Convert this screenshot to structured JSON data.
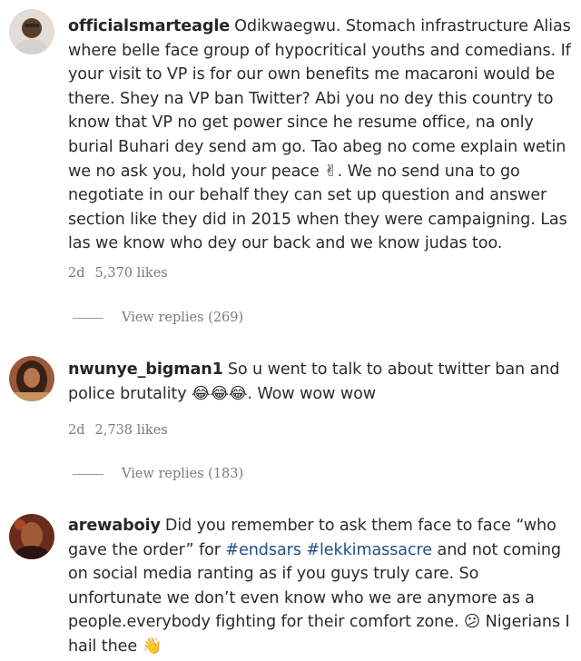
{
  "comments": [
    {
      "username": "officialsmarteagle",
      "avatar_icon": "user-avatar-photo",
      "text": "Odikwaegwu. Stomach infrastructure Alias where belle face group of hypocritical youths and comedians. If your visit to VP is for our own benefits me macaroni would be there. Shey na VP ban Twitter? Abi you no dey this country to know that VP no get power since he resume office, na only burial Buhari dey send am go. Tao abeg no come explain wetin we no ask you, hold your peace ✌. We no send una to go negotiate in our behalf they can set up question and answer section like they did in 2015 when they were campaigning. Las las we know who dey our back and we know judas too.",
      "age": "2d",
      "likes": "5,370 likes",
      "replies": "View replies (269)"
    },
    {
      "username": "nwunye_bigman1",
      "avatar_icon": "user-avatar-photo",
      "text": "So u went to talk to about twitter ban and police brutality 😂😂😂. Wow wow wow",
      "age": "2d",
      "likes": "2,738 likes",
      "replies": "View replies (183)"
    },
    {
      "username": "arewaboiy",
      "avatar_icon": "user-avatar-photo",
      "text_before": "Did you remember to ask them face to face “who gave the order” for ",
      "hashtag1": "#endsars",
      "hashtag2": "#lekkimassacre",
      "text_after": " and not coming on social media ranting as if you guys truly care. So unfortunate we don’t even know who we are anymore as a people.everybody fighting for their comfort zone. 😕 Nigerians I hail thee 👋"
    }
  ],
  "colors": {
    "username": "#262626",
    "text": "#2b2b2b",
    "meta": "#7a7a7a",
    "hashtag": "#1f4f85"
  }
}
